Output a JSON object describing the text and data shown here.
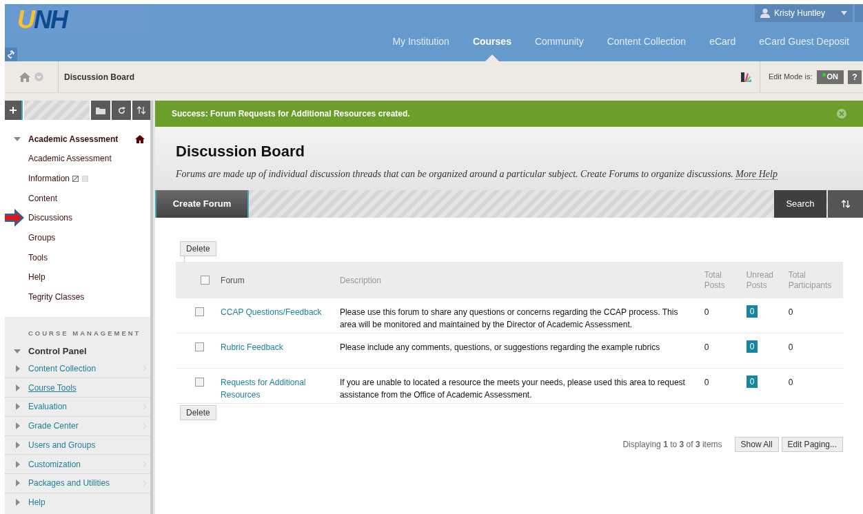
{
  "header": {
    "logo": "UNH",
    "user": "Kristy Huntley",
    "nav": [
      {
        "label": "My Institution",
        "selected": false
      },
      {
        "label": "Courses",
        "selected": true
      },
      {
        "label": "Community",
        "selected": false
      },
      {
        "label": "Content Collection",
        "selected": false
      },
      {
        "label": "eCard",
        "selected": false
      },
      {
        "label": "eCard Guest Deposit",
        "selected": false
      }
    ]
  },
  "breadcrumb": {
    "title": "Discussion Board",
    "edit_mode_label": "Edit Mode is:",
    "edit_mode": {
      "on": true,
      "label": "ON"
    },
    "help": "?"
  },
  "sidebar": {
    "course": {
      "title": "Academic Assessment",
      "expanded": true,
      "items": [
        {
          "label": "Academic Assessment",
          "status_icons": false,
          "annotated": false
        },
        {
          "label": "Information",
          "status_icons": true,
          "annotated": false
        },
        {
          "label": "Content",
          "status_icons": false,
          "annotated": false
        },
        {
          "label": "Discussions",
          "status_icons": false,
          "annotated": true
        },
        {
          "label": "Groups",
          "status_icons": false,
          "annotated": false
        },
        {
          "label": "Tools",
          "status_icons": false,
          "annotated": false
        },
        {
          "label": "Help",
          "status_icons": false,
          "annotated": false
        },
        {
          "label": "Tegrity Classes",
          "status_icons": false,
          "annotated": false
        }
      ]
    },
    "management": {
      "heading": "COURSE MANAGEMENT",
      "title": "Control Panel",
      "expanded": true,
      "items": [
        {
          "label": "Content Collection",
          "hovered": false,
          "submenu": true
        },
        {
          "label": "Course Tools",
          "hovered": true,
          "submenu": false
        },
        {
          "label": "Evaluation",
          "hovered": false,
          "submenu": true
        },
        {
          "label": "Grade Center",
          "hovered": false,
          "submenu": true
        },
        {
          "label": "Users and Groups",
          "hovered": false,
          "submenu": false
        },
        {
          "label": "Customization",
          "hovered": false,
          "submenu": true
        },
        {
          "label": "Packages and Utilities",
          "hovered": false,
          "submenu": true
        },
        {
          "label": "Help",
          "hovered": false,
          "submenu": false
        }
      ]
    }
  },
  "success": "Success: Forum Requests for Additional Resources created.",
  "page": {
    "title": "Discussion Board",
    "description": "Forums are made up of individual discussion threads that can be organized around a particular subject. Create Forums to organize discussions.",
    "more_help": "More Help"
  },
  "actions": {
    "create": "Create Forum",
    "search": "Search"
  },
  "table": {
    "delete_top": "Delete",
    "delete_bottom": "Delete",
    "all_checked": false,
    "columns": [
      "Forum",
      "Description",
      "Total Posts",
      "Unread Posts",
      "Total Participants"
    ],
    "rows": [
      {
        "checked": false,
        "forum": "CCAP Questions/Feedback",
        "description": "Please use this forum to share any questions or concerns regarding the CCAP process. This area will be monitored and maintained by the Director of Academic Assessment.",
        "total": "0",
        "unread": "0",
        "participants": "0"
      },
      {
        "checked": false,
        "forum": "Rubric Feedback",
        "description": "Please include any comments, questions, or suggestions regarding the example rubrics",
        "total": "0",
        "unread": "0",
        "participants": "0"
      },
      {
        "checked": false,
        "forum": "Requests for Additional Resources",
        "description": "If you are unable to located a resource the meets your needs, please used this area to request assistance from the Office of Academic Assessment.",
        "total": "0",
        "unread": "0",
        "participants": "0"
      }
    ]
  },
  "paging": {
    "summary": "Displaying **1** to **3** of **3** items",
    "show_all": "Show All",
    "edit_paging": "Edit Paging..."
  }
}
